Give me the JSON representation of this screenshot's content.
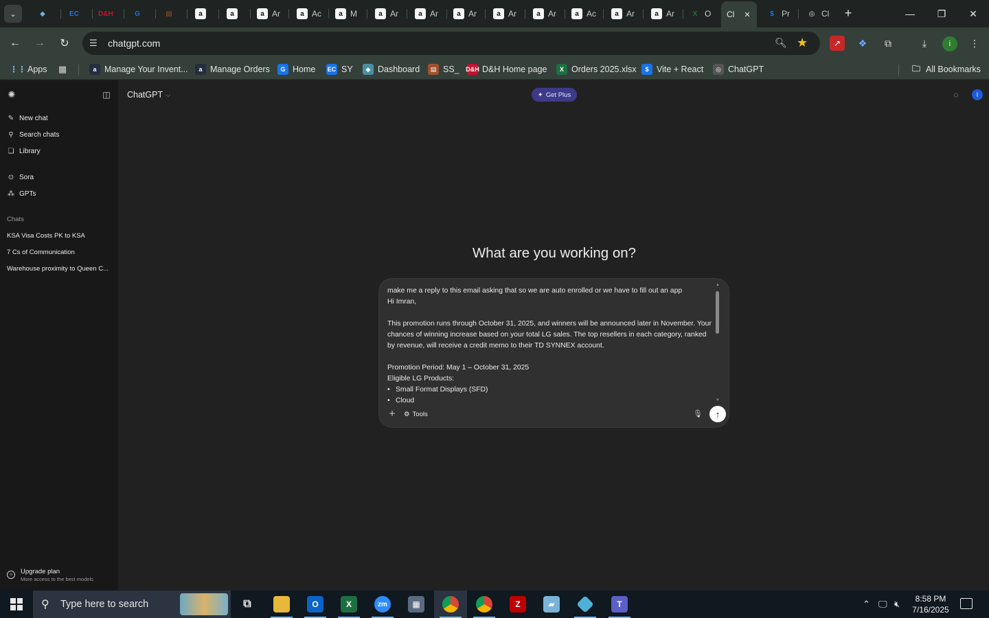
{
  "browser": {
    "tabs": [
      {
        "fav": "◆",
        "color": "#6fb3d2",
        "label": ""
      },
      {
        "fav": "EC",
        "color": "#1a73e8",
        "label": ""
      },
      {
        "fav": "D&H",
        "color": "#c8102e",
        "label": ""
      },
      {
        "fav": "G",
        "color": "#1a73e8",
        "label": ""
      },
      {
        "fav": "▤",
        "color": "#a0522d",
        "label": ""
      },
      {
        "fav": "a",
        "color": "#ffffff",
        "label": ""
      },
      {
        "fav": "a",
        "color": "#ffffff",
        "label": ""
      },
      {
        "fav": "a",
        "color": "#ffffff",
        "label": "Ar"
      },
      {
        "fav": "a",
        "color": "#ffffff",
        "label": "Ac"
      },
      {
        "fav": "a",
        "color": "#ffffff",
        "label": "M"
      },
      {
        "fav": "a",
        "color": "#ffffff",
        "label": "Ar"
      },
      {
        "fav": "a",
        "color": "#ffffff",
        "label": "Ar"
      },
      {
        "fav": "a",
        "color": "#ffffff",
        "label": "Ar"
      },
      {
        "fav": "a",
        "color": "#ffffff",
        "label": "Ar"
      },
      {
        "fav": "a",
        "color": "#ffffff",
        "label": "Ar"
      },
      {
        "fav": "a",
        "color": "#ffffff",
        "label": "Ac"
      },
      {
        "fav": "a",
        "color": "#ffffff",
        "label": "Ar"
      },
      {
        "fav": "a",
        "color": "#ffffff",
        "label": "Ar"
      },
      {
        "fav": "X",
        "color": "#1d6f42",
        "label": "O"
      },
      {
        "fav": "",
        "color": "",
        "label": "Cl"
      },
      {
        "fav": "$",
        "color": "#1a73e8",
        "label": "Pr"
      },
      {
        "fav": "◎",
        "color": "#dddddd",
        "label": "Cl"
      }
    ],
    "url": "chatgpt.com",
    "bookmarks": {
      "apps": "Apps",
      "items": [
        {
          "label": "Manage Your Invent...",
          "fav": "a",
          "color": "#232f3e"
        },
        {
          "label": "Manage Orders",
          "fav": "a",
          "color": "#232f3e"
        },
        {
          "label": "Home",
          "fav": "G",
          "color": "#1a73e8"
        },
        {
          "label": "SY",
          "fav": "EC",
          "color": "#1a73e8"
        },
        {
          "label": "Dashboard",
          "fav": "◆",
          "color": "#4a90a4"
        },
        {
          "label": "SS_",
          "fav": "▤",
          "color": "#a0522d"
        },
        {
          "label": "D&H Home page",
          "fav": "D&H",
          "color": "#c8102e"
        },
        {
          "label": "Orders 2025.xlsx",
          "fav": "X",
          "color": "#1d6f42"
        },
        {
          "label": "Vite + React",
          "fav": "$",
          "color": "#1a73e8"
        },
        {
          "label": "ChatGPT",
          "fav": "◎",
          "color": "#555555"
        }
      ],
      "all": "All Bookmarks"
    }
  },
  "sidebar": {
    "new_chat": "New chat",
    "search_chats": "Search chats",
    "library": "Library",
    "sora": "Sora",
    "gpts": "GPTs",
    "chats_heading": "Chats",
    "chats": [
      "KSA Visa Costs PK to KSA",
      "7 Cs of Communication",
      "Warehouse proximity to Queen C..."
    ],
    "upgrade_title": "Upgrade plan",
    "upgrade_sub": "More access to the best models"
  },
  "main": {
    "model": "ChatGPT",
    "get_plus": "Get Plus",
    "user_initial": "I",
    "headline": "What are you working on?",
    "prompt_lines": [
      "make me a reply to this email asking that so we are auto enrolled or we have to fill out an app",
      "Hi Imran,",
      "",
      "This promotion runs through October 31, 2025, and winners will be announced later in November. Your chances of winning increase based on your total LG sales. The top resellers in each category, ranked by revenue, will receive a credit memo to their TD SYNNEX account.",
      "",
      "Promotion Period: May 1 – October 31, 2025",
      "Eligible LG Products:"
    ],
    "prompt_bullets": [
      "Small Format Displays (SFD)",
      "Cloud"
    ],
    "tools": "Tools"
  },
  "taskbar": {
    "search_placeholder": "Type here to search",
    "time": "8:58 PM",
    "date": "7/16/2025"
  }
}
